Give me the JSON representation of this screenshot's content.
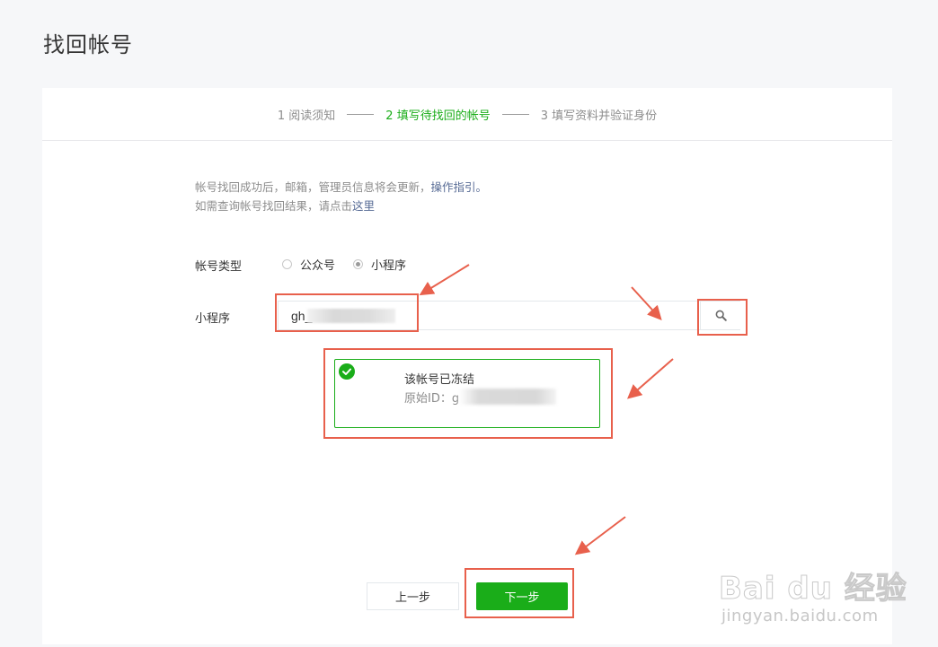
{
  "page": {
    "title": "找回帐号"
  },
  "steps": [
    {
      "label": "1 阅读须知",
      "state": "done"
    },
    {
      "label": "2 填写待找回的帐号",
      "state": "active"
    },
    {
      "label": "3 填写资料并验证身份",
      "state": "pending"
    }
  ],
  "notice": {
    "line1_text": "帐号找回成功后，邮箱，管理员信息将会更新，",
    "line1_link": "操作指引。",
    "line2_text": "如需查询帐号找回结果，请点击",
    "line2_link": "这里"
  },
  "form": {
    "account_type_label": "帐号类型",
    "options": [
      {
        "label": "公众号",
        "checked": false
      },
      {
        "label": "小程序",
        "checked": true
      }
    ],
    "account_label": "小程序",
    "account_value": "gh_5"
  },
  "result": {
    "status": "该帐号已冻结",
    "id_label": "原始ID：g"
  },
  "buttons": {
    "prev": "上一步",
    "next": "下一步"
  },
  "watermark": {
    "brand": "Bai du 经验",
    "url": "jingyan.baidu.com"
  },
  "colors": {
    "accent": "#1aad19",
    "highlight": "#e8604c",
    "link": "#576b95"
  }
}
